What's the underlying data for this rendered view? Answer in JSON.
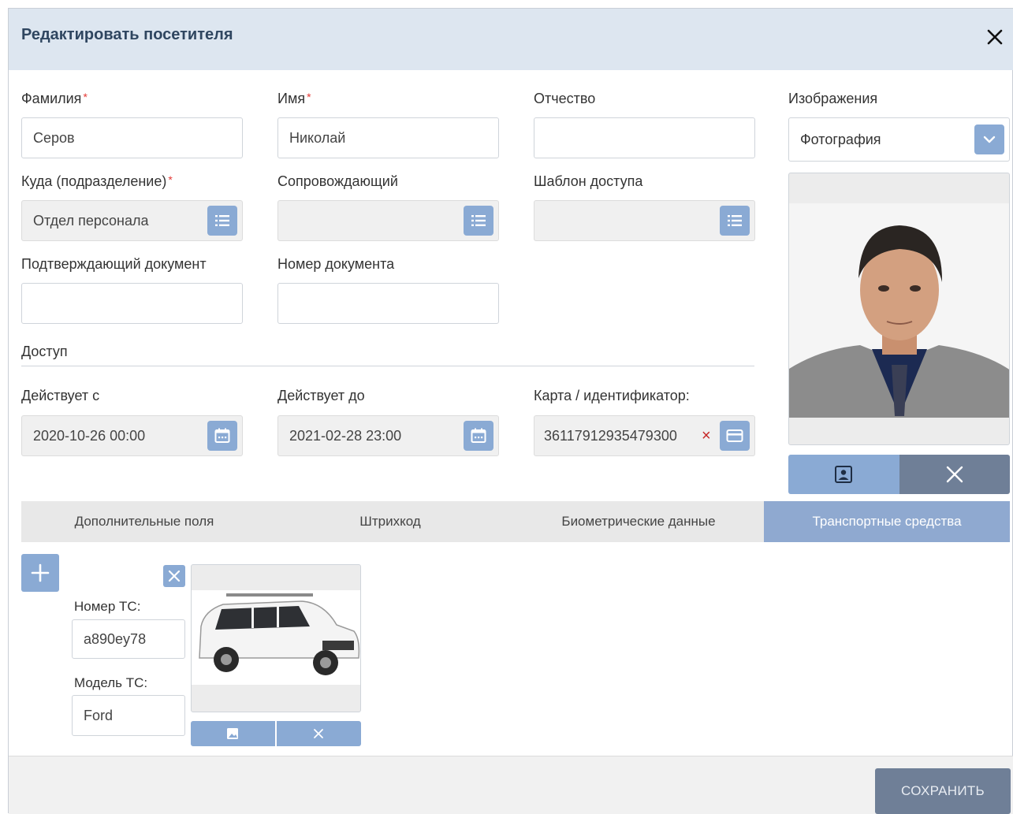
{
  "dialog": {
    "title": "Редактировать посетителя"
  },
  "fields": {
    "last_name": {
      "label": "Фамилия",
      "required_mark": "*",
      "value": "Серов"
    },
    "first_name": {
      "label": "Имя",
      "required_mark": "*",
      "value": "Николай"
    },
    "patronymic": {
      "label": "Отчество",
      "value": ""
    },
    "department": {
      "label": "Куда (подразделение)",
      "required_mark": "*",
      "value": "Отдел персонала"
    },
    "escort": {
      "label": "Сопровождающий",
      "value": ""
    },
    "access_template": {
      "label": "Шаблон доступа",
      "value": ""
    },
    "document": {
      "label": "Подтверждающий документ",
      "value": ""
    },
    "document_number": {
      "label": "Номер документа",
      "value": ""
    }
  },
  "access": {
    "section_title": "Доступ",
    "valid_from": {
      "label": "Действует с",
      "value": "2020-10-26 00:00"
    },
    "valid_to": {
      "label": "Действует до",
      "value": "2021-02-28 23:00"
    },
    "card": {
      "label": "Карта / идентификатор:",
      "value": "36117912935479300",
      "clear_glyph": "×"
    }
  },
  "images": {
    "label": "Изображения",
    "selected": "Фотография"
  },
  "tabs": [
    {
      "label": "Дополнительные поля",
      "active": false
    },
    {
      "label": "Штрихкод",
      "active": false
    },
    {
      "label": "Биометрические данные",
      "active": false
    },
    {
      "label": "Транспортные средства",
      "active": true
    }
  ],
  "vehicle": {
    "number_label": "Номер ТС:",
    "number_value": "a890ey78",
    "model_label": "Модель ТС:",
    "model_value": "Ford"
  },
  "footer": {
    "save_label": "СОХРАНИТЬ"
  },
  "colors": {
    "header_bg": "#dde6f0",
    "accent": "#8aaad4",
    "dark_button": "#6f7f97",
    "required": "#e53935",
    "title": "#2f4660"
  },
  "icons": [
    "close-icon",
    "list-icon",
    "calendar-icon",
    "card-icon",
    "chevron-down-icon",
    "portrait-icon",
    "plus-icon",
    "image-icon"
  ]
}
